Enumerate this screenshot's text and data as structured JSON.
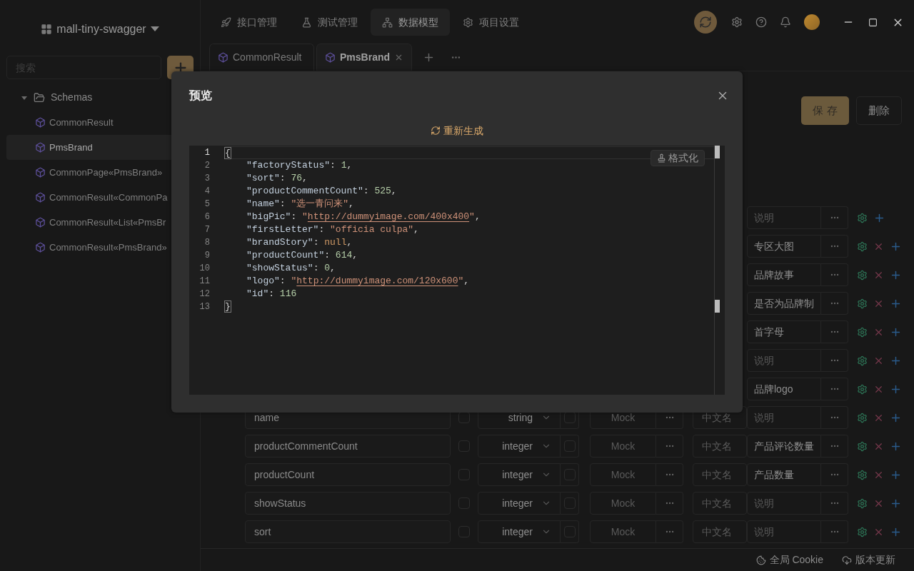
{
  "sidebar": {
    "project": "mall-tiny-swagger",
    "search": {
      "placeholder": "搜索"
    },
    "tree": [
      {
        "label": "Schemas",
        "expanded": true,
        "children": [
          {
            "label": "CommonResult",
            "selected": false
          },
          {
            "label": "PmsBrand",
            "selected": true
          },
          {
            "label": "CommonPage«PmsBrand»",
            "selected": false
          },
          {
            "label": "CommonResult«CommonPa",
            "selected": false
          },
          {
            "label": "CommonResult«List«PmsBr",
            "selected": false
          },
          {
            "label": "CommonResult«PmsBrand»",
            "selected": false
          }
        ]
      }
    ]
  },
  "nav": [
    {
      "kind": "api",
      "label": "接口管理",
      "selected": false
    },
    {
      "kind": "test",
      "label": "测试管理",
      "selected": false
    },
    {
      "kind": "model",
      "label": "数据模型",
      "selected": true
    },
    {
      "kind": "settings",
      "label": "项目设置",
      "selected": false
    }
  ],
  "doc_tabs": [
    {
      "label": "CommonResult",
      "selected": false,
      "closable": false
    },
    {
      "label": "PmsBrand",
      "selected": true,
      "closable": true
    }
  ],
  "actions": {
    "save": "保 存",
    "delete": "删除"
  },
  "fields": [
    {
      "description_placeholder": "说明",
      "deletable": false
    },
    {
      "description": "专区大图",
      "deletable": true
    },
    {
      "description": "品牌故事",
      "deletable": true
    },
    {
      "description": "是否为品牌制",
      "deletable": true
    },
    {
      "description": "首字母",
      "deletable": true
    },
    {
      "description_placeholder": "说明",
      "deletable": true
    },
    {
      "description": "品牌logo",
      "deletable": true
    },
    {
      "name": "name",
      "required": false,
      "type": "string",
      "nullable": false,
      "mock_placeholder": "Mock",
      "title_placeholder": "中文名",
      "description_placeholder": "说明",
      "deletable": true
    },
    {
      "name": "productCommentCount",
      "required": false,
      "type": "integer",
      "nullable": false,
      "mock_placeholder": "Mock",
      "title_placeholder": "中文名",
      "description": "产品评论数量",
      "deletable": true
    },
    {
      "name": "productCount",
      "required": false,
      "type": "integer",
      "nullable": false,
      "mock_placeholder": "Mock",
      "title_placeholder": "中文名",
      "description": "产品数量",
      "deletable": true
    },
    {
      "name": "showStatus",
      "required": false,
      "type": "integer",
      "nullable": false,
      "mock_placeholder": "Mock",
      "title_placeholder": "中文名",
      "description_placeholder": "说明",
      "deletable": true
    },
    {
      "name": "sort",
      "required": false,
      "type": "integer",
      "nullable": false,
      "mock_placeholder": "Mock",
      "title_placeholder": "中文名",
      "description_placeholder": "说明",
      "deletable": true
    }
  ],
  "modal": {
    "title": "预览",
    "regenerate": "重新生成",
    "format": "格式化",
    "lines": [
      {
        "number": "1",
        "current": true,
        "indented": false,
        "tokens": [
          {
            "kind": "bracket",
            "text": "{"
          }
        ]
      },
      {
        "number": "2",
        "current": false,
        "indented": true,
        "tokens": [
          {
            "kind": "key",
            "text": "\"factoryStatus\""
          },
          {
            "kind": "punct",
            "text": ": "
          },
          {
            "kind": "number",
            "text": "1"
          },
          {
            "kind": "punct",
            "text": ","
          }
        ]
      },
      {
        "number": "3",
        "current": false,
        "indented": true,
        "tokens": [
          {
            "kind": "key",
            "text": "\"sort\""
          },
          {
            "kind": "punct",
            "text": ": "
          },
          {
            "kind": "number",
            "text": "76"
          },
          {
            "kind": "punct",
            "text": ","
          }
        ]
      },
      {
        "number": "4",
        "current": false,
        "indented": true,
        "tokens": [
          {
            "kind": "key",
            "text": "\"productCommentCount\""
          },
          {
            "kind": "punct",
            "text": ": "
          },
          {
            "kind": "number",
            "text": "525"
          },
          {
            "kind": "punct",
            "text": ","
          }
        ]
      },
      {
        "number": "5",
        "current": false,
        "indented": true,
        "tokens": [
          {
            "kind": "key",
            "text": "\"name\""
          },
          {
            "kind": "punct",
            "text": ": "
          },
          {
            "kind": "string",
            "text": "\"选一青问来\""
          },
          {
            "kind": "punct",
            "text": ","
          }
        ]
      },
      {
        "number": "6",
        "current": false,
        "indented": true,
        "tokens": [
          {
            "kind": "key",
            "text": "\"bigPic\""
          },
          {
            "kind": "punct",
            "text": ": "
          },
          {
            "kind": "string",
            "text": "\""
          },
          {
            "kind": "link",
            "text": "http://dummyimage.com/400x400"
          },
          {
            "kind": "string",
            "text": "\""
          },
          {
            "kind": "punct",
            "text": ","
          }
        ]
      },
      {
        "number": "7",
        "current": false,
        "indented": true,
        "tokens": [
          {
            "kind": "key",
            "text": "\"firstLetter\""
          },
          {
            "kind": "punct",
            "text": ": "
          },
          {
            "kind": "string",
            "text": "\"officia culpa\""
          },
          {
            "kind": "punct",
            "text": ","
          }
        ]
      },
      {
        "number": "8",
        "current": false,
        "indented": true,
        "tokens": [
          {
            "kind": "key",
            "text": "\"brandStory\""
          },
          {
            "kind": "punct",
            "text": ": "
          },
          {
            "kind": "null",
            "text": "null"
          },
          {
            "kind": "punct",
            "text": ","
          }
        ]
      },
      {
        "number": "9",
        "current": false,
        "indented": true,
        "tokens": [
          {
            "kind": "key",
            "text": "\"productCount\""
          },
          {
            "kind": "punct",
            "text": ": "
          },
          {
            "kind": "number",
            "text": "614"
          },
          {
            "kind": "punct",
            "text": ","
          }
        ]
      },
      {
        "number": "10",
        "current": false,
        "indented": true,
        "tokens": [
          {
            "kind": "key",
            "text": "\"showStatus\""
          },
          {
            "kind": "punct",
            "text": ": "
          },
          {
            "kind": "number",
            "text": "0"
          },
          {
            "kind": "punct",
            "text": ","
          }
        ]
      },
      {
        "number": "11",
        "current": false,
        "indented": true,
        "tokens": [
          {
            "kind": "key",
            "text": "\"logo\""
          },
          {
            "kind": "punct",
            "text": ": "
          },
          {
            "kind": "string",
            "text": "\""
          },
          {
            "kind": "link",
            "text": "http://dummyimage.com/120x600"
          },
          {
            "kind": "string",
            "text": "\""
          },
          {
            "kind": "punct",
            "text": ","
          }
        ]
      },
      {
        "number": "12",
        "current": false,
        "indented": true,
        "tokens": [
          {
            "kind": "key",
            "text": "\"id\""
          },
          {
            "kind": "punct",
            "text": ": "
          },
          {
            "kind": "number",
            "text": "116"
          }
        ]
      },
      {
        "number": "13",
        "current": false,
        "indented": false,
        "tokens": [
          {
            "kind": "bracket",
            "text": "}"
          }
        ]
      }
    ]
  },
  "status_bar": [
    {
      "kind": "cookie",
      "label": "全局 Cookie"
    },
    {
      "kind": "update",
      "label": "版本更新"
    }
  ]
}
